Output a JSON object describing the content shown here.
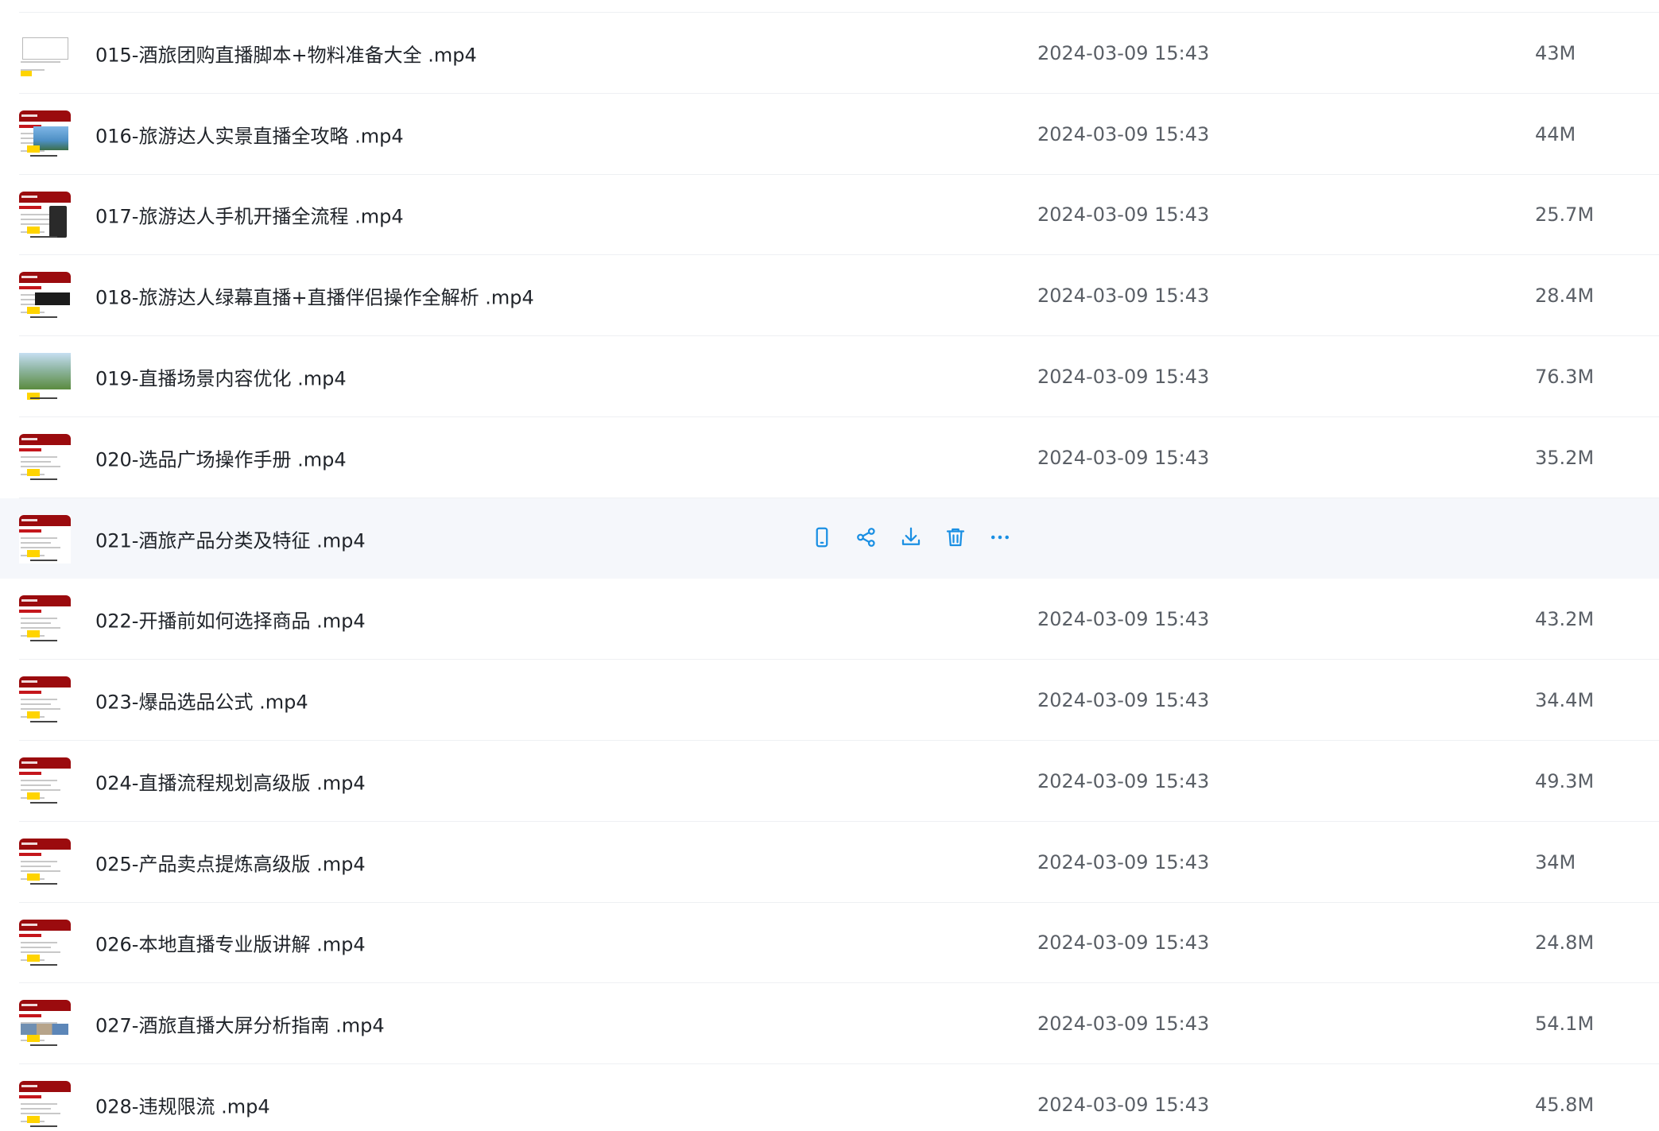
{
  "colors": {
    "accent": "#1a8fe3",
    "thumbnail_red": "#9b0b0e",
    "hover_row": "#f5f7fb"
  },
  "files": [
    {
      "name": "015-酒旅团购直播脚本+物料准备大全 .mp4",
      "date": "2024-03-09 15:43",
      "size": "43M",
      "thumb": "doc"
    },
    {
      "name": "016-旅游达人实景直播全攻略 .mp4",
      "date": "2024-03-09 15:43",
      "size": "44M",
      "thumb": "photo"
    },
    {
      "name": "017-旅游达人手机开播全流程 .mp4",
      "date": "2024-03-09 15:43",
      "size": "25.7M",
      "thumb": "phone"
    },
    {
      "name": "018-旅游达人绿幕直播+直播伴侣操作全解析 .mp4",
      "date": "2024-03-09 15:43",
      "size": "28.4M",
      "thumb": "dark"
    },
    {
      "name": "019-直播场景内容优化 .mp4",
      "date": "2024-03-09 15:43",
      "size": "76.3M",
      "thumb": "landscape"
    },
    {
      "name": "020-选品广场操作手册 .mp4",
      "date": "2024-03-09 15:43",
      "size": "35.2M",
      "thumb": "plain"
    },
    {
      "name": "021-酒旅产品分类及特征 .mp4",
      "date": "",
      "size": "",
      "thumb": "red",
      "hovered": true
    },
    {
      "name": "022-开播前如何选择商品 .mp4",
      "date": "2024-03-09 15:43",
      "size": "43.2M",
      "thumb": "red"
    },
    {
      "name": "023-爆品选品公式 .mp4",
      "date": "2024-03-09 15:43",
      "size": "34.4M",
      "thumb": "red"
    },
    {
      "name": "024-直播流程规划高级版 .mp4",
      "date": "2024-03-09 15:43",
      "size": "49.3M",
      "thumb": "red"
    },
    {
      "name": "025-产品卖点提炼高级版 .mp4",
      "date": "2024-03-09 15:43",
      "size": "34M",
      "thumb": "red"
    },
    {
      "name": "026-本地直播专业版讲解 .mp4",
      "date": "2024-03-09 15:43",
      "size": "24.8M",
      "thumb": "red"
    },
    {
      "name": "027-酒旅直播大屏分析指南 .mp4",
      "date": "2024-03-09 15:43",
      "size": "54.1M",
      "thumb": "imgs"
    },
    {
      "name": "028-违规限流 .mp4",
      "date": "2024-03-09 15:43",
      "size": "45.8M",
      "thumb": "plain"
    }
  ],
  "hover_actions": [
    {
      "icon": "mobile-phone-icon",
      "name": "send-to-phone-button"
    },
    {
      "icon": "share-icon",
      "name": "share-button"
    },
    {
      "icon": "download-icon",
      "name": "download-button"
    },
    {
      "icon": "trash-icon",
      "name": "delete-button"
    },
    {
      "icon": "more-icon",
      "name": "more-button"
    }
  ]
}
